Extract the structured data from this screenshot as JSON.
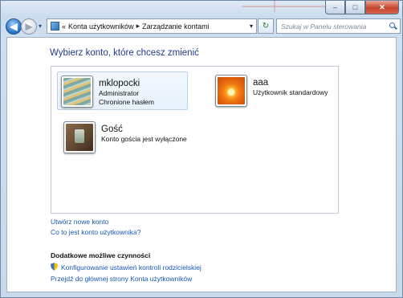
{
  "window": {
    "caption": {
      "minimize": "–",
      "maximize": "□",
      "close": "✕"
    }
  },
  "nav": {
    "back_glyph": "◀",
    "forward_glyph": "▶",
    "history_glyph": "▾",
    "breadcrumb_prefix": "«",
    "breadcrumbs": [
      "Konta użytkowników",
      "Zarządzanie kontami"
    ],
    "breadcrumb_sep": "▸",
    "address_dropdown": "▾",
    "refresh_glyph": "↻",
    "search_placeholder": "Szukaj w Panelu sterowania"
  },
  "page": {
    "title": "Wybierz konto, które chcesz zmienić",
    "accounts": [
      {
        "name": "mklopocki",
        "line1": "Administrator",
        "line2": "Chronione hasłem",
        "avatar": "stairs"
      },
      {
        "name": "aaa",
        "line1": "Użytkownik standardowy",
        "line2": "",
        "avatar": "flower"
      },
      {
        "name": "Gość",
        "line1": "Konto gościa jest wyłączone",
        "line2": "",
        "avatar": "guest"
      }
    ],
    "links": {
      "create": "Utwórz nowe konto",
      "what_is": "Co to jest konto użytkownika?"
    },
    "additional": {
      "heading": "Dodatkowe możliwe czynności",
      "parental": "Konfigurowanie ustawień kontroli rodzicielskiej",
      "main_page": "Przejdź do głównej strony Konta użytkowników"
    }
  },
  "colors": {
    "link": "#1a56b6",
    "title": "#1e3a8a"
  }
}
